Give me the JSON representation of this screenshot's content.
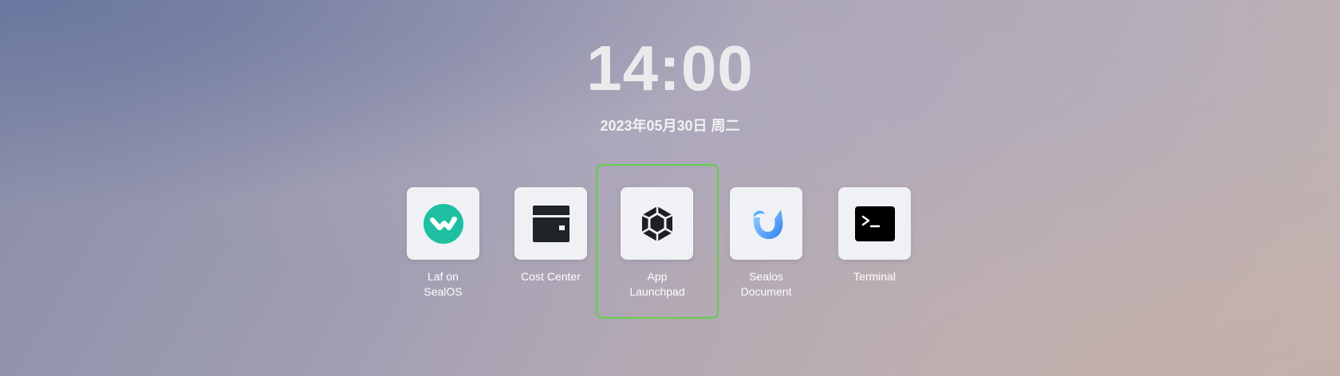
{
  "clock": {
    "time": "14:00"
  },
  "date": {
    "text": "2023年05月30日 周二"
  },
  "apps": [
    {
      "label": "Laf on\nSealOS",
      "icon": "laf-icon",
      "color": "#1fc0a2"
    },
    {
      "label": "Cost Center",
      "icon": "wallet-icon",
      "color": "#202428"
    },
    {
      "label": "App\nLaunchpad",
      "icon": "hexagon-cube-icon",
      "color": "#1e1f22",
      "selected": true
    },
    {
      "label": "Sealos\nDocument",
      "icon": "sealos-document-icon",
      "color": "#2f8cf0"
    },
    {
      "label": "Terminal",
      "icon": "terminal-icon",
      "color": "#000000"
    }
  ],
  "colors": {
    "selection_outline": "#5fd04a",
    "tile_background": "#f0f1f4"
  }
}
